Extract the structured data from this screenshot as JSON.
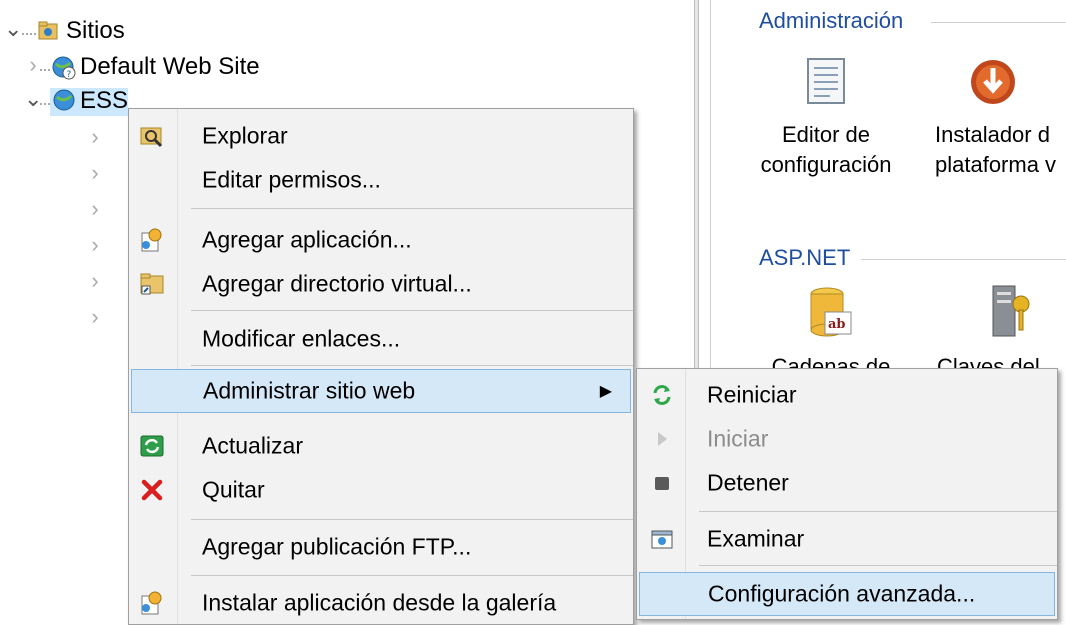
{
  "tree": {
    "sites_label": "Sitios",
    "default_site_label": "Default Web Site",
    "ess_label": "ESS"
  },
  "right_panel": {
    "groups": [
      {
        "title": "Administración",
        "features": [
          {
            "line1": "Editor de",
            "line2": "configuración",
            "icon": "config-editor-icon"
          },
          {
            "line1": "Instalador d",
            "line2": "plataforma v",
            "icon": "web-platform-installer-icon"
          }
        ]
      },
      {
        "title": "ASP.NET",
        "features": [
          {
            "label": "Cadenas de",
            "icon": "connection-strings-icon"
          },
          {
            "label": "Claves del",
            "icon": "machine-key-icon"
          }
        ]
      }
    ]
  },
  "context_menu": {
    "items": [
      {
        "label": "Explorar",
        "icon": "explore-icon"
      },
      {
        "label": "Editar permisos..."
      },
      {
        "label": "Agregar aplicación...",
        "icon": "add-application-icon"
      },
      {
        "label": "Agregar directorio virtual...",
        "icon": "add-virtual-directory-icon"
      },
      {
        "label": "Modificar enlaces..."
      },
      {
        "label": "Administrar sitio web",
        "has_submenu": true
      },
      {
        "label": "Actualizar",
        "icon": "refresh-icon"
      },
      {
        "label": "Quitar",
        "icon": "remove-icon"
      },
      {
        "label": "Agregar publicación FTP..."
      },
      {
        "label": "Instalar aplicación desde la galería",
        "icon": "install-gallery-icon"
      }
    ]
  },
  "submenu": {
    "items": [
      {
        "label": "Reiniciar",
        "icon": "restart-icon"
      },
      {
        "label": "Iniciar",
        "icon": "start-icon",
        "disabled": true
      },
      {
        "label": "Detener",
        "icon": "stop-icon"
      },
      {
        "label": "Examinar",
        "icon": "browse-icon"
      },
      {
        "label": "Configuración avanzada..."
      }
    ]
  },
  "colors": {
    "selection": "#cce8ff",
    "menu_highlight": "#d5e8f7",
    "group_title": "#1f4e9e",
    "remove_red": "#d81e1e"
  }
}
